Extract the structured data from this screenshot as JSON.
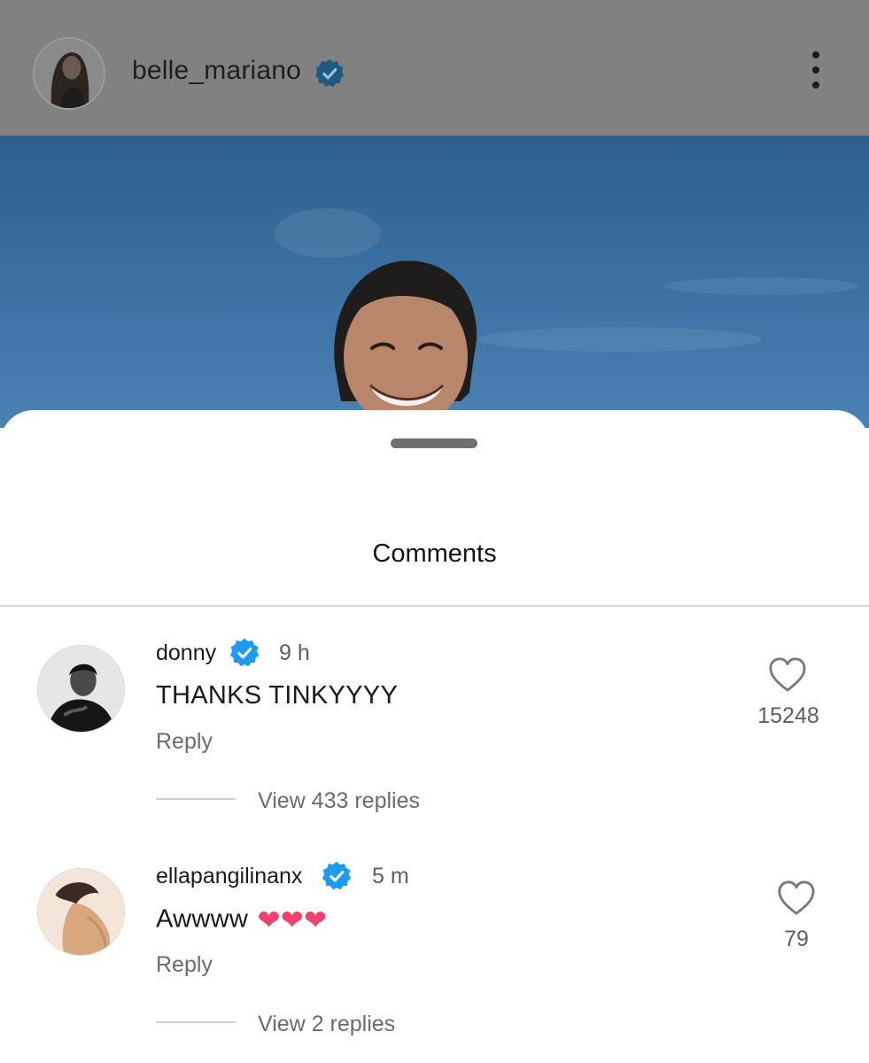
{
  "header": {
    "username": "belle_mariano",
    "verified": true,
    "more_icon": "more-vertical-icon"
  },
  "sheet": {
    "title": "Comments"
  },
  "comments": [
    {
      "username": "donny",
      "verified": true,
      "time": "9 h",
      "text": "THANKS TINKYYYY",
      "reply_label": "Reply",
      "view_replies": "View 433 replies",
      "likes": "15248"
    },
    {
      "username": "ellapangilinanx",
      "verified": true,
      "time": "5 m",
      "text": "Awwww",
      "emoji": "❤❤❤",
      "reply_label": "Reply",
      "view_replies": "View 2 replies",
      "likes": "79"
    }
  ],
  "colors": {
    "verified_blue": "#1d9bf0",
    "header_dim": "#818181",
    "sky": "#3a6fa0",
    "heart_emoji": "#f0426e"
  }
}
